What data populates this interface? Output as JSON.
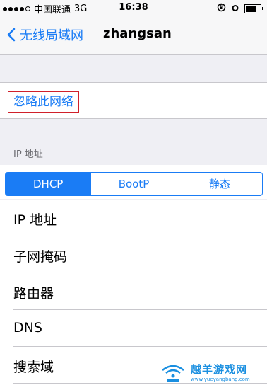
{
  "status_bar": {
    "carrier": "中国联通",
    "network": "3G",
    "time": "16:38",
    "signal_dots_filled": 4,
    "signal_dots_total": 5
  },
  "nav": {
    "back_label": "无线局域网",
    "title": "zhangsan"
  },
  "forget_button": "忽略此网络",
  "section_header": "IP 地址",
  "segmented": {
    "options": [
      "DHCP",
      "BootP",
      "静态"
    ],
    "selected": "DHCP"
  },
  "rows": [
    {
      "label": "IP 地址"
    },
    {
      "label": "子网掩码"
    },
    {
      "label": "路由器"
    },
    {
      "label": "DNS"
    },
    {
      "label": "搜索域"
    }
  ],
  "watermark": {
    "main": "越羊游戏网",
    "url": "www.yueyangbang.com"
  },
  "colors": {
    "accent": "#1a7cf5",
    "highlight_border": "#d0202a",
    "background": "#efeff4"
  }
}
